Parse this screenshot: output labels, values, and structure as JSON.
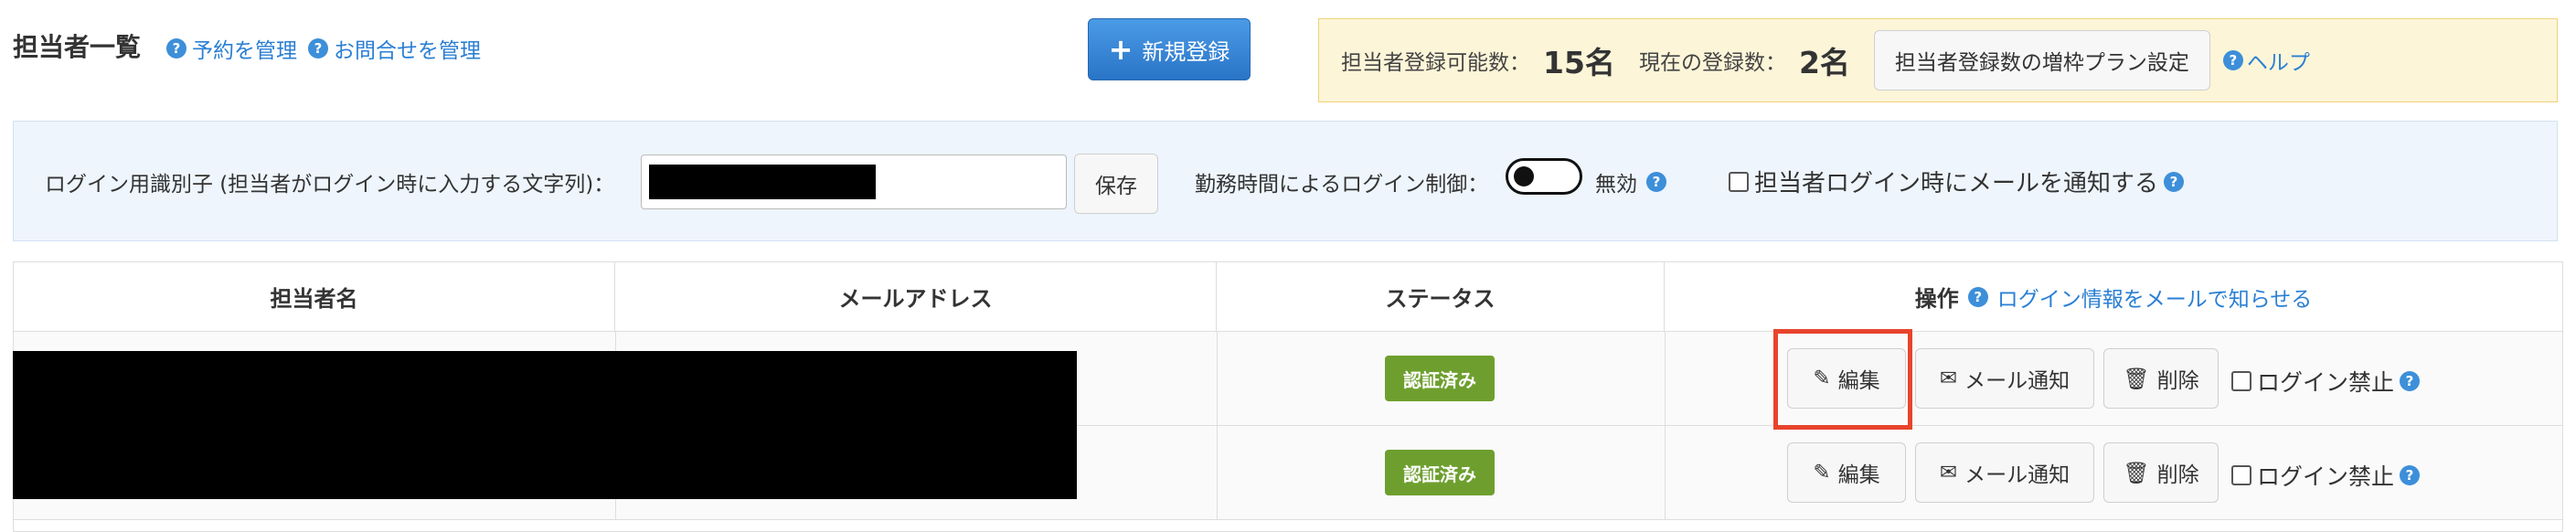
{
  "header": {
    "title": "担当者一覧",
    "links": [
      {
        "label": "予約を管理"
      },
      {
        "label": "お問合せを管理"
      }
    ],
    "new_button": "新規登録",
    "quota": {
      "capacity_label": "担当者登録可能数：",
      "capacity_value": "15名",
      "current_label": "現在の登録数：",
      "current_value": "2名",
      "plan_button": "担当者登録数の増枠プラン設定",
      "help_link": "ヘルプ"
    }
  },
  "settings": {
    "login_id_label": "ログイン用識別子 (担当者がログイン時に入力する文字列)：",
    "save_button": "保存",
    "worktime_label": "勤務時間によるログイン制御：",
    "toggle_state": "無効",
    "notify_label": "担当者ログイン時にメールを通知する"
  },
  "table": {
    "columns": [
      "担当者名",
      "メールアドレス",
      "ステータス",
      "操作"
    ],
    "ops_link": "ログイン情報をメールで知らせる",
    "rows": [
      {
        "status": "認証済み",
        "edit": "編集",
        "mail": "メール通知",
        "delete": "削除",
        "lock": "ログイン禁止"
      },
      {
        "status": "認証済み",
        "edit": "編集",
        "mail": "メール通知",
        "delete": "削除",
        "lock": "ログイン禁止"
      }
    ]
  },
  "icons": {
    "help": "?"
  },
  "colors": {
    "accent": "#2a7fd4",
    "badge": "#6e9f2e",
    "highlight": "#e8442c"
  }
}
